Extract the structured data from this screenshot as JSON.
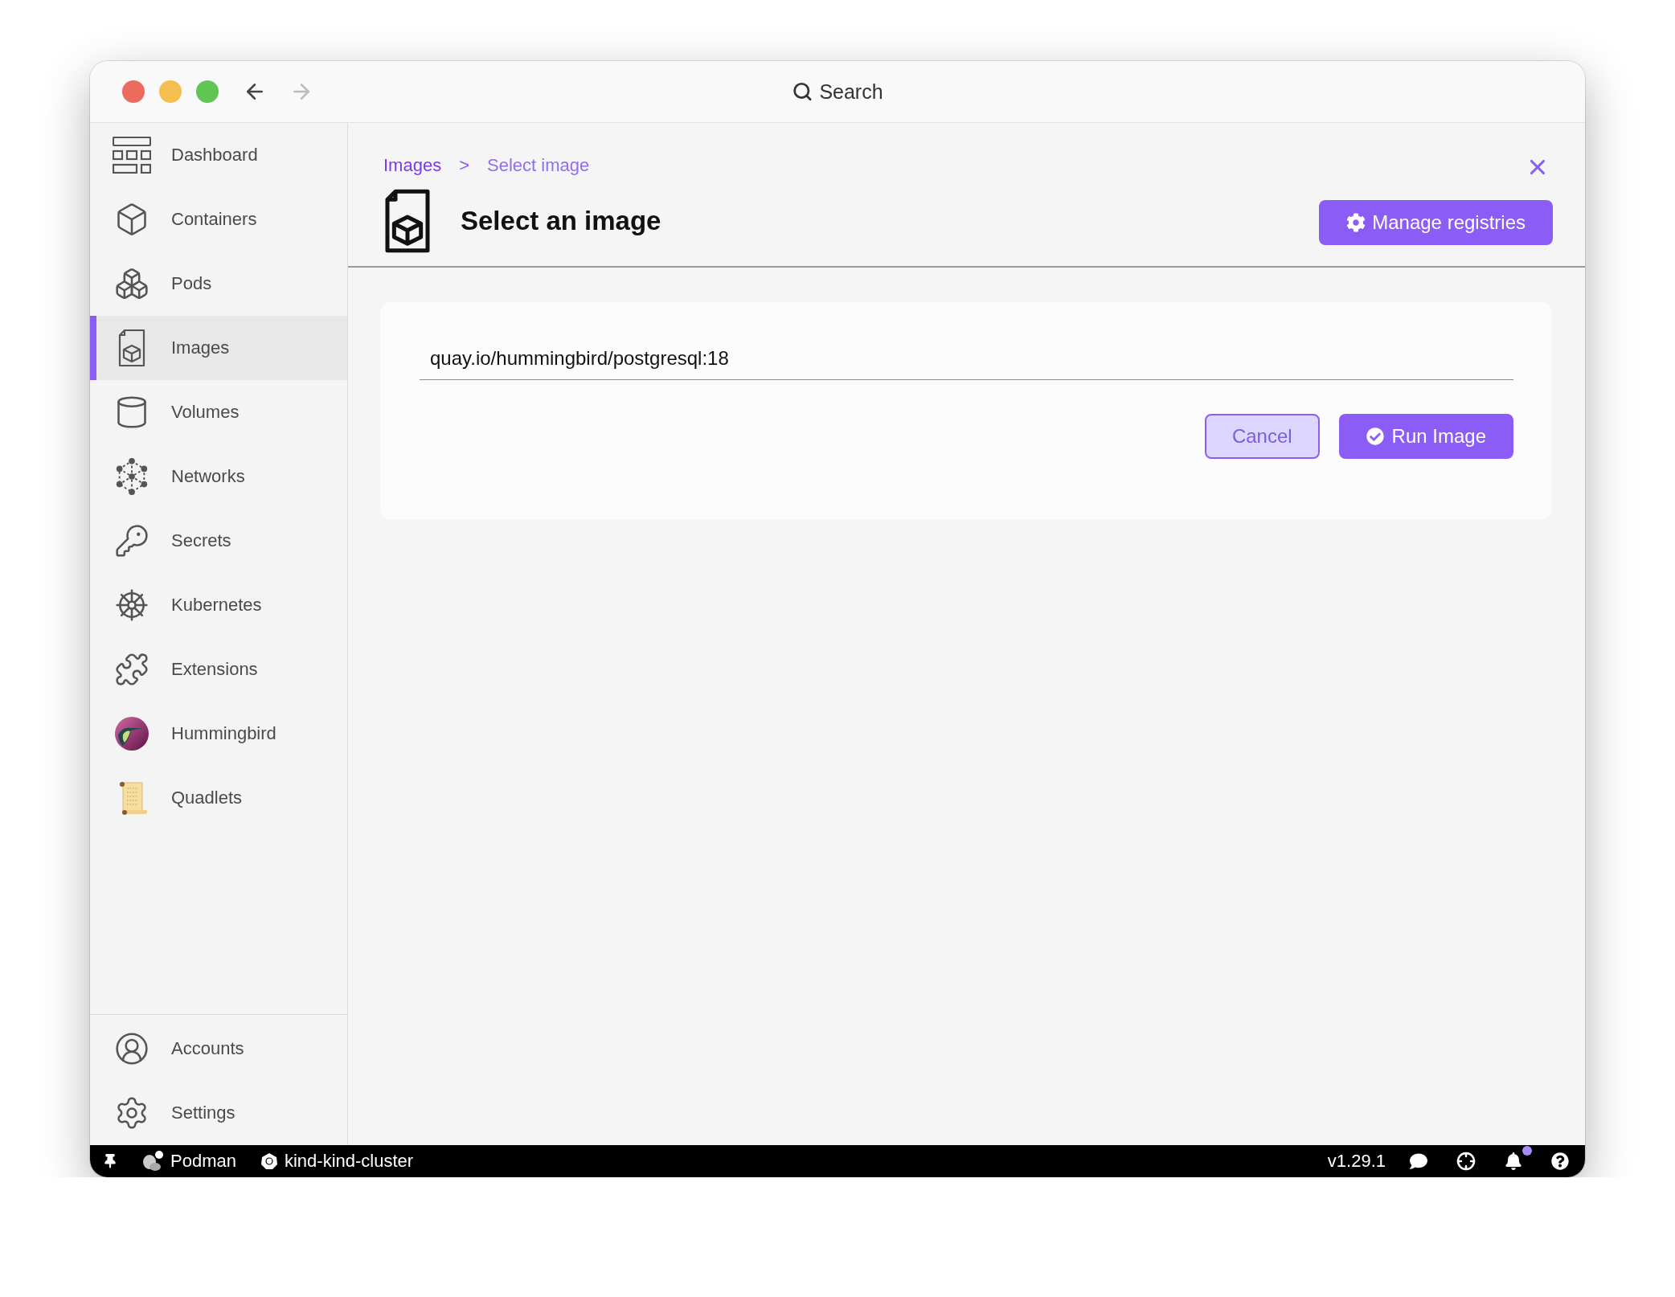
{
  "window": {
    "navigation": [
      {
        "kind": "back",
        "disabled": false
      },
      {
        "kind": "forward",
        "disabled": true
      }
    ],
    "search": {
      "placeholder": "Search"
    }
  },
  "sidebar": {
    "items": [
      {
        "label": "Dashboard",
        "kind": "dashboard",
        "selected": false
      },
      {
        "label": "Containers",
        "kind": "containers",
        "selected": false
      },
      {
        "label": "Pods",
        "kind": "pods",
        "selected": false
      },
      {
        "label": "Images",
        "kind": "images",
        "selected": true
      },
      {
        "label": "Volumes",
        "kind": "volumes",
        "selected": false
      },
      {
        "label": "Networks",
        "kind": "networks",
        "selected": false
      },
      {
        "label": "Secrets",
        "kind": "secrets",
        "selected": false
      },
      {
        "label": "Kubernetes",
        "kind": "kubernetes",
        "selected": false
      },
      {
        "label": "Extensions",
        "kind": "extensions",
        "selected": false
      },
      {
        "label": "Hummingbird",
        "kind": "hummingbird",
        "selected": false
      },
      {
        "label": "Quadlets",
        "kind": "quadlets",
        "selected": false
      }
    ],
    "footer_items": [
      {
        "label": "Accounts",
        "kind": "accounts",
        "selected": false
      },
      {
        "label": "Settings",
        "kind": "settings",
        "selected": false
      }
    ]
  },
  "header": {
    "breadcrumb": {
      "parent": "Images",
      "separator": ">",
      "current": "Select image"
    },
    "title": "Select an image",
    "action": "Manage registries"
  },
  "form": {
    "image": {
      "value": "quay.io/hummingbird/postgresql:18"
    },
    "buttons": [
      {
        "kind": "secondary",
        "label": "Cancel"
      },
      {
        "kind": "primary",
        "label": "Run Image"
      }
    ]
  },
  "status_bar": {
    "left": [
      {
        "kind": "pin"
      },
      {
        "kind": "podman",
        "label": "Podman"
      },
      {
        "kind": "kubernetes",
        "label": "kind-kind-cluster"
      }
    ],
    "version": "v1.29.1",
    "right": [
      {
        "kind": "chat",
        "unread": false
      },
      {
        "kind": "target",
        "unread": false
      },
      {
        "kind": "bell",
        "unread": true
      },
      {
        "kind": "help",
        "unread": false
      }
    ]
  }
}
